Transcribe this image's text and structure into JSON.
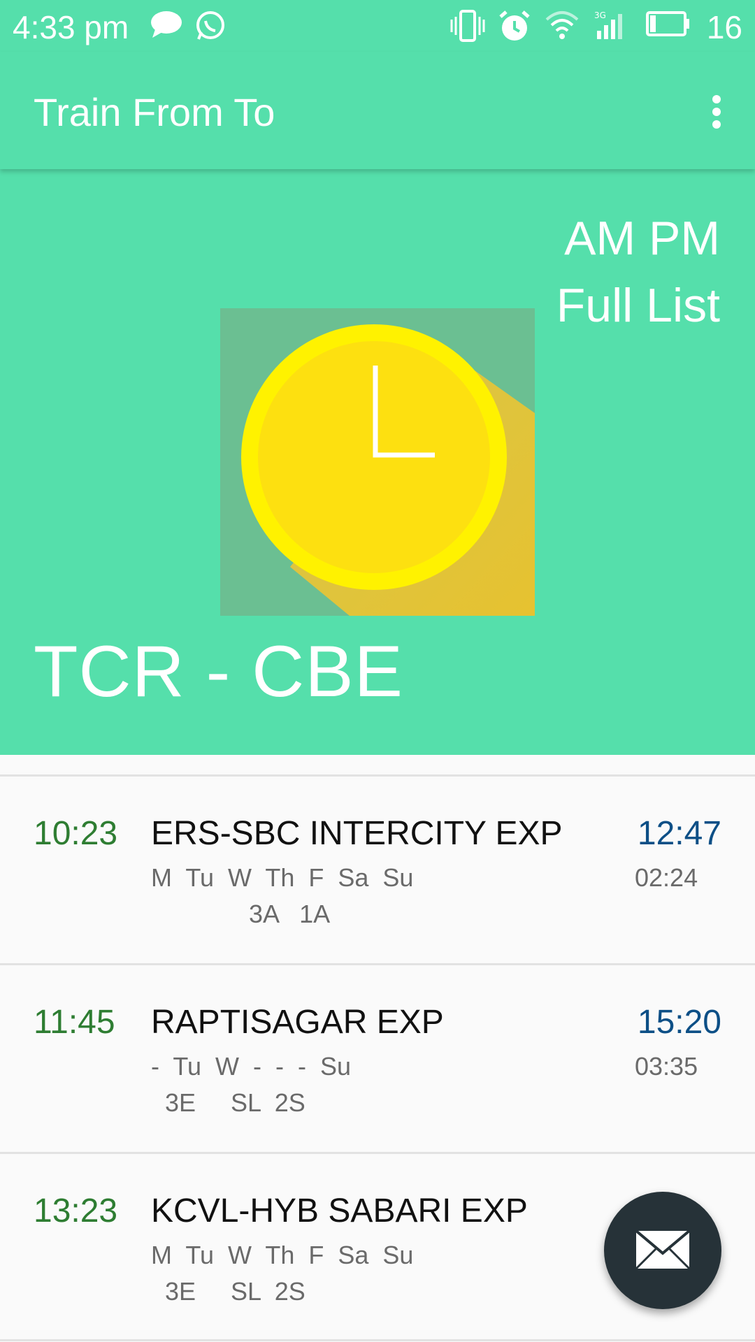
{
  "status_bar": {
    "time": "4:33 pm",
    "battery_level": "16",
    "icons": [
      "chat-icon",
      "whatsapp-icon",
      "vibrate-icon",
      "alarm-icon",
      "wifi-icon",
      "signal-3g-icon",
      "battery-icon"
    ]
  },
  "app_bar": {
    "title": "Train From To",
    "menu_icon": "overflow-menu-icon"
  },
  "hero": {
    "ampm_label": "AM  PM",
    "full_list_label": "Full List",
    "route": "TCR - CBE",
    "illustration_icon": "clock-icon"
  },
  "trains": [
    {
      "departure": "10:23",
      "name": "ERS-SBC INTERCITY EXP",
      "days": "M  Tu  W  Th  F  Sa  Su",
      "classes": "              3A   1A",
      "arrival": "12:47",
      "duration": "02:24"
    },
    {
      "departure": "11:45",
      "name": "RAPTISAGAR EXP",
      "days": "-  Tu  W  -  -  -  Su",
      "classes": "  3E     SL  2S",
      "arrival": "15:20",
      "duration": "03:35"
    },
    {
      "departure": "13:23",
      "name": "KCVL-HYB SABARI EXP",
      "days": "M  Tu  W  Th  F  Sa  Su",
      "classes": "  3E     SL  2S",
      "arrival": "",
      "duration": ""
    }
  ],
  "fab": {
    "icon": "mail-icon"
  },
  "colors": {
    "primary": "#55dfab",
    "departure_time": "#2e7d32",
    "arrival_time": "#0d4f86",
    "fab": "#263238"
  }
}
